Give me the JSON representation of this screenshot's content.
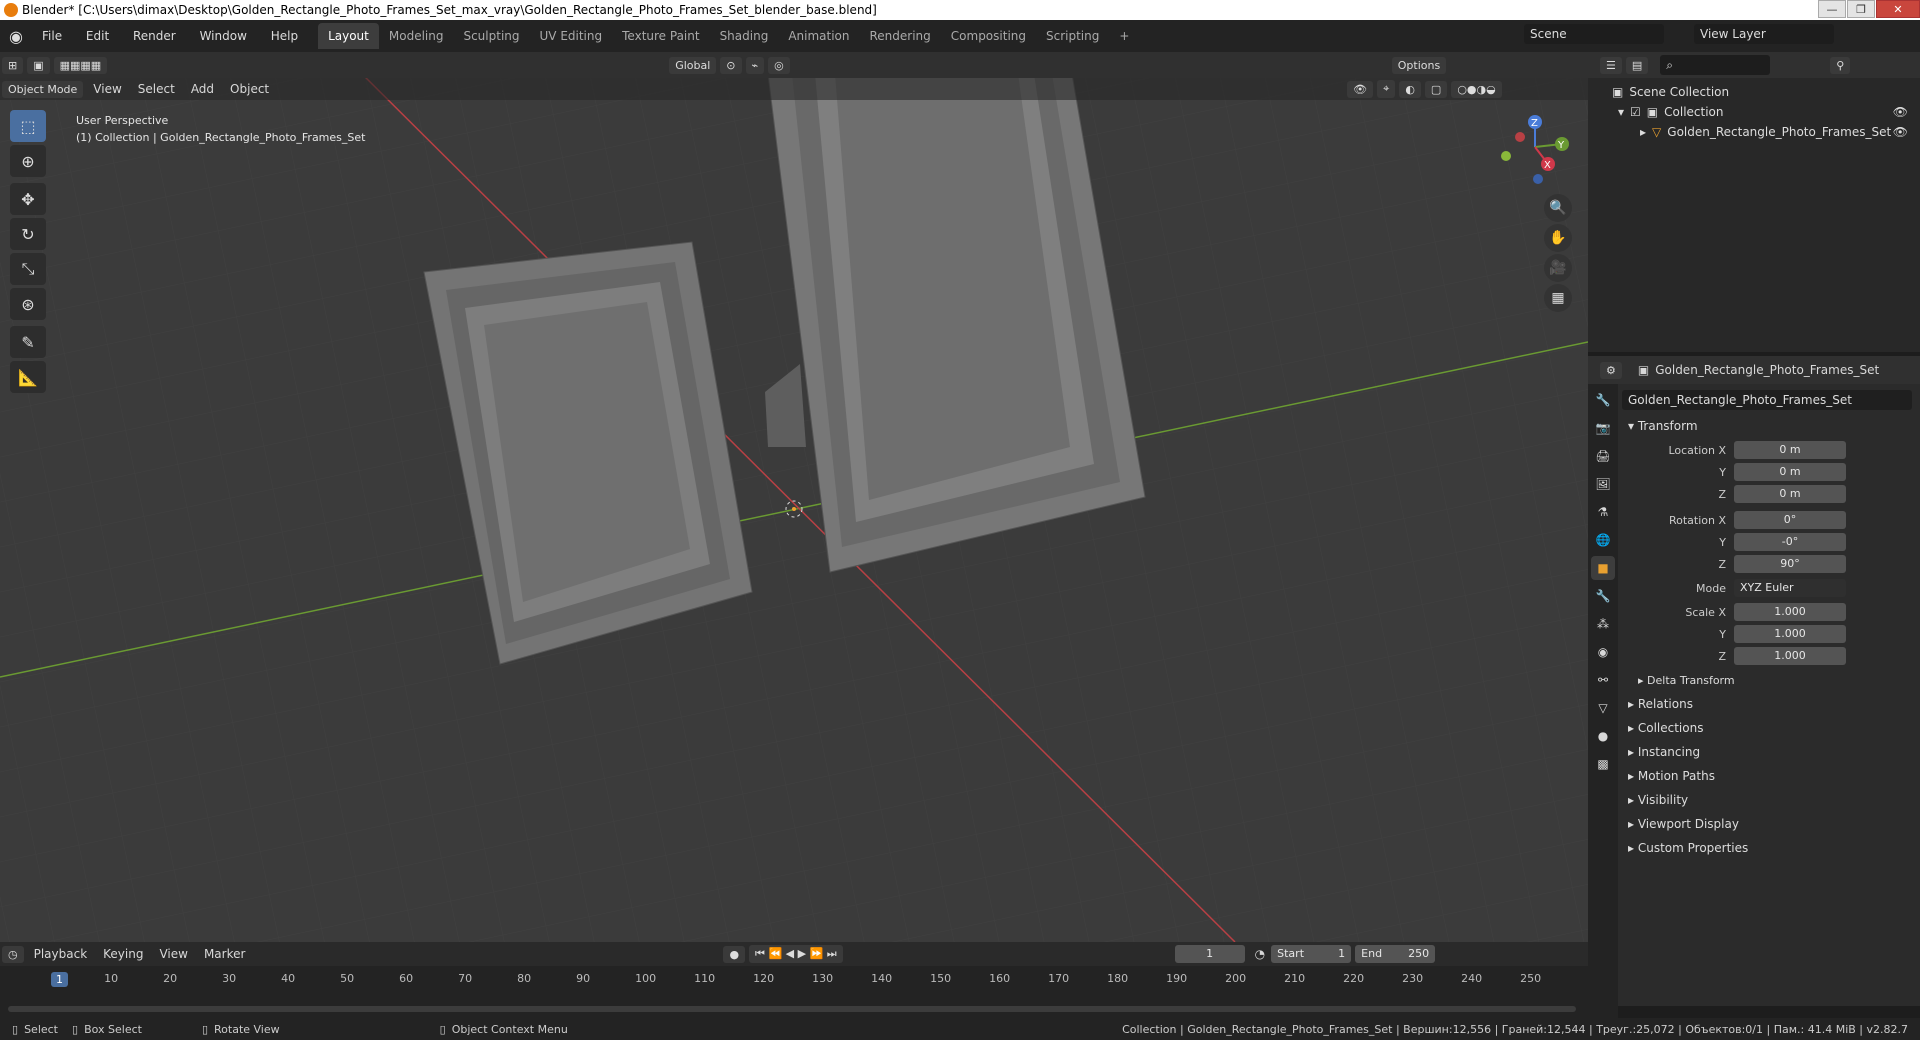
{
  "title": "Blender* [C:\\Users\\dimax\\Desktop\\Golden_Rectangle_Photo_Frames_Set_max_vray\\Golden_Rectangle_Photo_Frames_Set_blender_base.blend]",
  "menu": [
    "File",
    "Edit",
    "Render",
    "Window",
    "Help"
  ],
  "workspaces": [
    "Layout",
    "Modeling",
    "Sculpting",
    "UV Editing",
    "Texture Paint",
    "Shading",
    "Animation",
    "Rendering",
    "Compositing",
    "Scripting"
  ],
  "scene_label": "Scene",
  "view_layer_label": "View Layer",
  "header": {
    "mode": "Object Mode",
    "menus": [
      "View",
      "Select",
      "Add",
      "Object"
    ],
    "orientation": "Global",
    "options": "Options"
  },
  "viewport": {
    "perspective": "User Perspective",
    "collection_info": "(1) Collection | Golden_Rectangle_Photo_Frames_Set"
  },
  "outliner": {
    "scene_collection": "Scene Collection",
    "collection": "Collection",
    "object": "Golden_Rectangle_Photo_Frames_Set"
  },
  "properties": {
    "object_name": "Golden_Rectangle_Photo_Frames_Set",
    "transform_title": "Transform",
    "location_label": "Location X",
    "location": [
      "0 m",
      "0 m",
      "0 m"
    ],
    "rotation_label": "Rotation X",
    "rotation": [
      "0°",
      "-0°",
      "90°"
    ],
    "mode_label": "Mode",
    "mode_value": "XYZ Euler",
    "scale_label": "Scale X",
    "scale": [
      "1.000",
      "1.000",
      "1.000"
    ],
    "axis_y": "Y",
    "axis_z": "Z",
    "delta": "Delta Transform",
    "sections": [
      "Relations",
      "Collections",
      "Instancing",
      "Motion Paths",
      "Visibility",
      "Viewport Display",
      "Custom Properties"
    ]
  },
  "timeline": {
    "menus": [
      "Playback",
      "Keying",
      "View",
      "Marker"
    ],
    "current_frame": "1",
    "start_label": "Start",
    "start": "1",
    "end_label": "End",
    "end": "250",
    "ticks": [
      "1",
      "10",
      "20",
      "30",
      "40",
      "50",
      "60",
      "70",
      "80",
      "90",
      "100",
      "110",
      "120",
      "130",
      "140",
      "150",
      "160",
      "170",
      "180",
      "190",
      "200",
      "210",
      "220",
      "230",
      "240",
      "250"
    ]
  },
  "status": {
    "select": "Select",
    "box_select": "Box Select",
    "rotate_view": "Rotate View",
    "context_menu": "Object Context Menu",
    "info": "Collection | Golden_Rectangle_Photo_Frames_Set | Вершин:12,556 | Граней:12,544 | Треуг.:25,072 | Объектов:0/1 | Пам.: 41.4 MiB | v2.82.7"
  },
  "colors": {
    "accent": "#4a6fa0",
    "x_axis": "#b84044",
    "y_axis": "#6a9a32",
    "frame": "#7a7a7a"
  }
}
